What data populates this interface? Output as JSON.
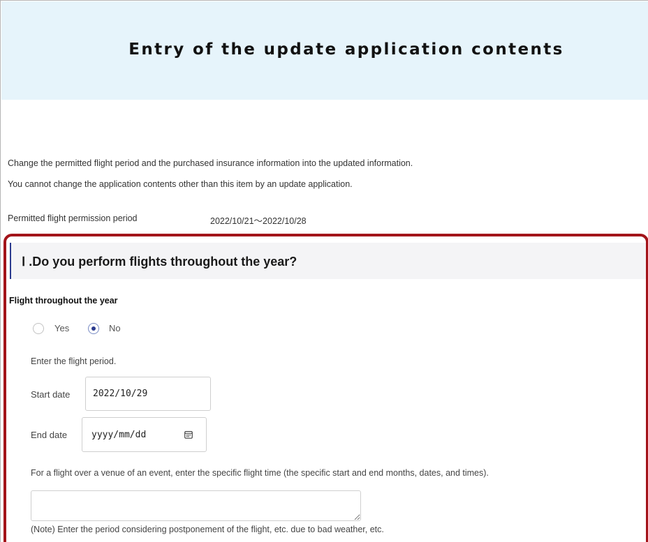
{
  "banner": {
    "title": "Entry of the update application contents"
  },
  "intro": {
    "line1": "Change the permitted flight period and the purchased insurance information into the updated information.",
    "line2": "You cannot change the application contents other than this item by an update application."
  },
  "permitted_period": {
    "label": "Permitted flight permission period",
    "value": "2022/10/21～2022/10/28"
  },
  "section": {
    "title": "Ⅰ .Do you perform flights throughout the year?",
    "field_label": "Flight throughout the year",
    "options": [
      {
        "label": "Yes",
        "selected": false
      },
      {
        "label": "No",
        "selected": true
      }
    ],
    "period_prompt": "Enter the flight period.",
    "start_date": {
      "label": "Start date",
      "value": "2022/10/29"
    },
    "end_date": {
      "label": "End date",
      "placeholder": "yyyy/mm/dd",
      "icon": "calendar-icon"
    },
    "event_prompt": "For a flight over a venue of an event, enter the specific flight time (the specific start and end months, dates, and times).",
    "event_time_value": "",
    "note": "(Note) Enter the period considering postponement of the flight, etc. due to bad weather, etc."
  },
  "colors": {
    "banner_bg": "#e6f4fb",
    "highlight_border": "#a3141a",
    "section_bg": "#f4f4f6",
    "accent": "#2b3b8f"
  }
}
